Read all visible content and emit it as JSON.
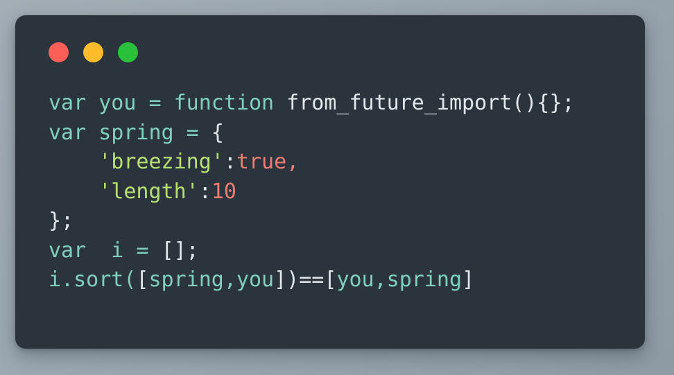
{
  "window": {
    "background_color": "#9aa6b0",
    "card_color": "#2b343c",
    "traffic_lights": [
      {
        "name": "close",
        "color": "#fc5f58"
      },
      {
        "name": "minimize",
        "color": "#fdbc2c"
      },
      {
        "name": "maximize",
        "color": "#2ac03c"
      }
    ]
  },
  "theme": {
    "keyword_color": "#7fd1bd",
    "identifier_color": "#7fd1bd",
    "punctuation_color": "#e1e7ea",
    "string_color": "#b6e072",
    "number_color": "#ef7b71",
    "boolean_color": "#ef7b71"
  },
  "code": {
    "language": "javascript",
    "lines": [
      {
        "index": 1,
        "text": "var you = function from_future_import(){};",
        "tokens": [
          {
            "t": "var you = function ",
            "c": "kw"
          },
          {
            "t": "from_future_import(){};",
            "c": "plain"
          }
        ]
      },
      {
        "index": 2,
        "text": "var spring = {",
        "tokens": [
          {
            "t": "var spring = ",
            "c": "kw"
          },
          {
            "t": "{",
            "c": "plain"
          }
        ]
      },
      {
        "index": 3,
        "text": "    'breezing':true,",
        "tokens": [
          {
            "t": "    ",
            "c": "plain"
          },
          {
            "t": "'breezing'",
            "c": "str"
          },
          {
            "t": ":",
            "c": "plain"
          },
          {
            "t": "true,",
            "c": "bool"
          }
        ]
      },
      {
        "index": 4,
        "text": "    'length':10",
        "tokens": [
          {
            "t": "    ",
            "c": "plain"
          },
          {
            "t": "'length'",
            "c": "str"
          },
          {
            "t": ":",
            "c": "plain"
          },
          {
            "t": "10",
            "c": "num"
          }
        ]
      },
      {
        "index": 5,
        "text": "};",
        "tokens": [
          {
            "t": "};",
            "c": "plain"
          }
        ]
      },
      {
        "index": 6,
        "text": "var  i = [];",
        "tokens": [
          {
            "t": "var  i = ",
            "c": "kw"
          },
          {
            "t": "[];",
            "c": "plain"
          }
        ]
      },
      {
        "index": 7,
        "text": "i.sort([spring,you])==[you,spring]",
        "tokens": [
          {
            "t": "i.sort(",
            "c": "ident"
          },
          {
            "t": "[",
            "c": "plain"
          },
          {
            "t": "spring,you",
            "c": "ident"
          },
          {
            "t": "])==[",
            "c": "plain"
          },
          {
            "t": "you,spring",
            "c": "ident"
          },
          {
            "t": "]",
            "c": "plain"
          }
        ]
      }
    ]
  }
}
